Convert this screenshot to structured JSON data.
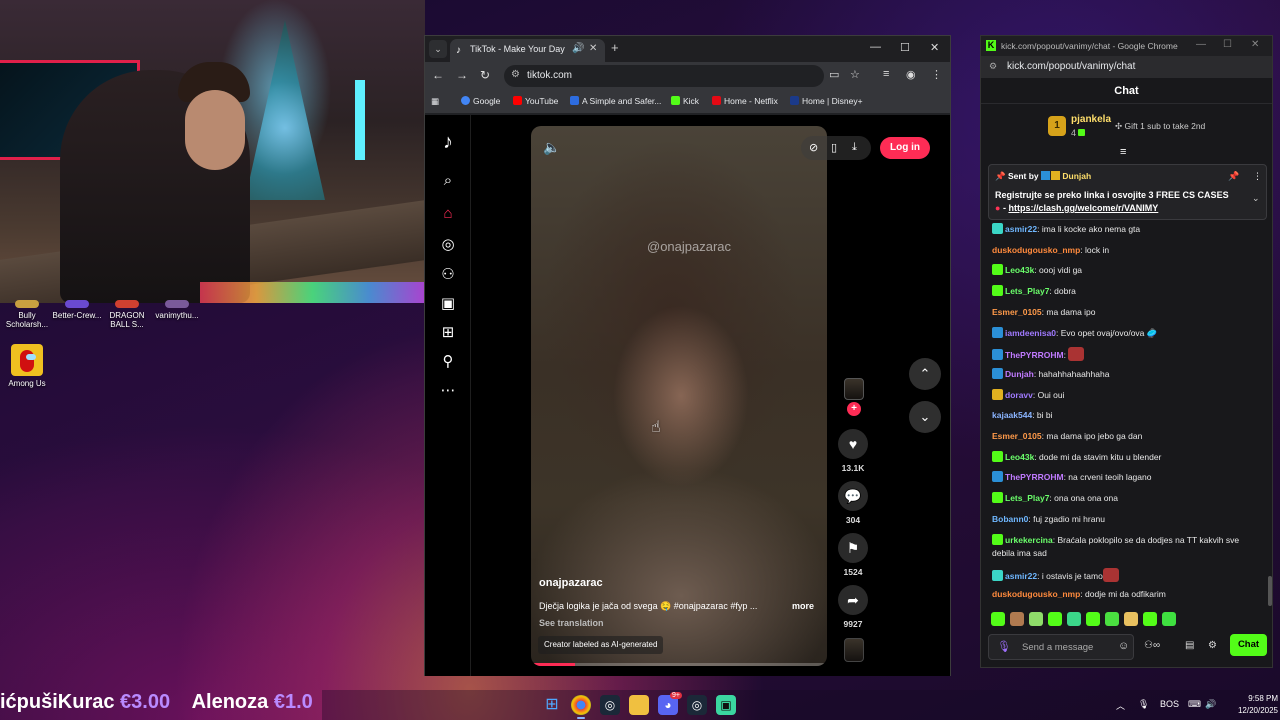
{
  "desktop": {
    "icons": [
      {
        "label": "Bully Scholarsh..."
      },
      {
        "label": "Better-Crew..."
      },
      {
        "label": "DRAGON BALL S..."
      },
      {
        "label": "vanimythu..."
      },
      {
        "label": "Among Us"
      }
    ]
  },
  "browser": {
    "tab_title": "TikTok - Make Your Day",
    "url": "tiktok.com",
    "bookmarks": [
      {
        "label": "Google",
        "color": "#4285f4"
      },
      {
        "label": "YouTube",
        "color": "#ff0000"
      },
      {
        "label": "A Simple and Safer...",
        "color": "#2d6cdf"
      },
      {
        "label": "Kick",
        "color": "#53fc18"
      },
      {
        "label": "Home - Netflix",
        "color": "#e50914"
      },
      {
        "label": "Home | Disney+",
        "color": "#1b3a8a"
      }
    ]
  },
  "tiktok": {
    "login_label": "Log in",
    "watermark": "@onajpazarac",
    "author": "onajpazarac",
    "caption": "Dječja logika je jača od svega 🤤 #onajpazarac #fyp ...",
    "more_label": "more",
    "see_translation": "See translation",
    "ai_label": "Creator labeled as AI-generated",
    "progress": 0.15,
    "likes": "13.1K",
    "comments": "304",
    "saves": "1524",
    "shares": "9927",
    "accent": "#fe2c55"
  },
  "chat": {
    "window_title": "kick.com/popout/vanimy/chat - Google Chrome",
    "url": "kick.com/popout/vanimy/chat",
    "header": "Chat",
    "top_gifter": {
      "rank": "1",
      "name": "pjankela",
      "count": "4",
      "cta": "Gift 1 sub to take 2nd"
    },
    "pinned": {
      "sent_by": "Sent by",
      "user": "Dunjah",
      "message": "Registrujte se preko linka i osvojite 3 FREE CS CASES",
      "link_prefix": "- ",
      "link": "https://clash.gg/welcome/r/VANIMY"
    },
    "messages": [
      {
        "user": "asmir22",
        "color": "#6fb7ff",
        "text": ": ima li kocke ako nema gta",
        "badge": "#3bd6c6"
      },
      {
        "user": "duskodugousko_nmp",
        "color": "#ff8a3d",
        "text": ": lock in",
        "badge": ""
      },
      {
        "user": "Leo43k",
        "color": "#6bff6b",
        "text": ": oooj vidi ga",
        "badge": "#53fc18"
      },
      {
        "user": "Lets_Play7",
        "color": "#6bff6b",
        "text": ": dobra",
        "badge": "#53fc18"
      },
      {
        "user": "Esmer_0105",
        "color": "#ff9a4a",
        "text": ": ma dama ipo",
        "badge": ""
      },
      {
        "user": "iamdeenisa0",
        "color": "#a07aff",
        "text": ": Evo opet ovaj/ovo/ova 🥏",
        "badge": "#2b8fd6"
      },
      {
        "user": "ThePYRROHM",
        "color": "#c07aff",
        "text": ": ",
        "badge": "#2b8fd6",
        "emote": true
      },
      {
        "user": "Dunjah",
        "color": "#c07aff",
        "text": ": hahahhahaahhaha",
        "badge": "#2b8fd6"
      },
      {
        "user": "doravv",
        "color": "#a07aff",
        "text": ": Oui oui",
        "badge": "#e0b020"
      },
      {
        "user": "kajaak544",
        "color": "#8ab4ff",
        "text": ": bi bi",
        "badge": ""
      },
      {
        "user": "Esmer_0105",
        "color": "#ff9a4a",
        "text": ": ma dama ipo jebo ga dan",
        "badge": ""
      },
      {
        "user": "Leo43k",
        "color": "#6bff6b",
        "text": ": dode mi da stavim kitu u blender",
        "badge": "#53fc18"
      },
      {
        "user": "ThePYRROHM",
        "color": "#c07aff",
        "text": ": na crveni teoih lagano",
        "badge": "#2b8fd6"
      },
      {
        "user": "Lets_Play7",
        "color": "#6bff6b",
        "text": ": ona ona ona ona",
        "badge": "#53fc18"
      },
      {
        "user": "Bobann0",
        "color": "#6fb7ff",
        "text": ": fuj zgadio mi hranu",
        "badge": ""
      },
      {
        "user": "urkekercina",
        "color": "#6bff6b",
        "text": ": Braćala poklopilo se da dodjes na TT kakvih sve debila ima sad",
        "badge": "#53fc18"
      },
      {
        "user": "asmir22",
        "color": "#6fb7ff",
        "text": ": i ostavis je tamo",
        "badge": "#3bd6c6",
        "emote": true
      },
      {
        "user": "duskodugousko_nmp",
        "color": "#ff8a3d",
        "text": ": dodje mi da odfikarim",
        "badge": ""
      }
    ],
    "input_placeholder": "Send a message",
    "send_label": "Chat",
    "accent": "#53fc18"
  },
  "ticker": {
    "items": [
      {
        "name": "ićpušiKurac",
        "amount": "€3.00"
      },
      {
        "name": "Alenoza",
        "amount": "€1.0"
      }
    ]
  },
  "taskbar": {
    "language": "BOS",
    "time": "9:58 PM",
    "date": "12/20/2025",
    "notif_badge": "9+"
  }
}
